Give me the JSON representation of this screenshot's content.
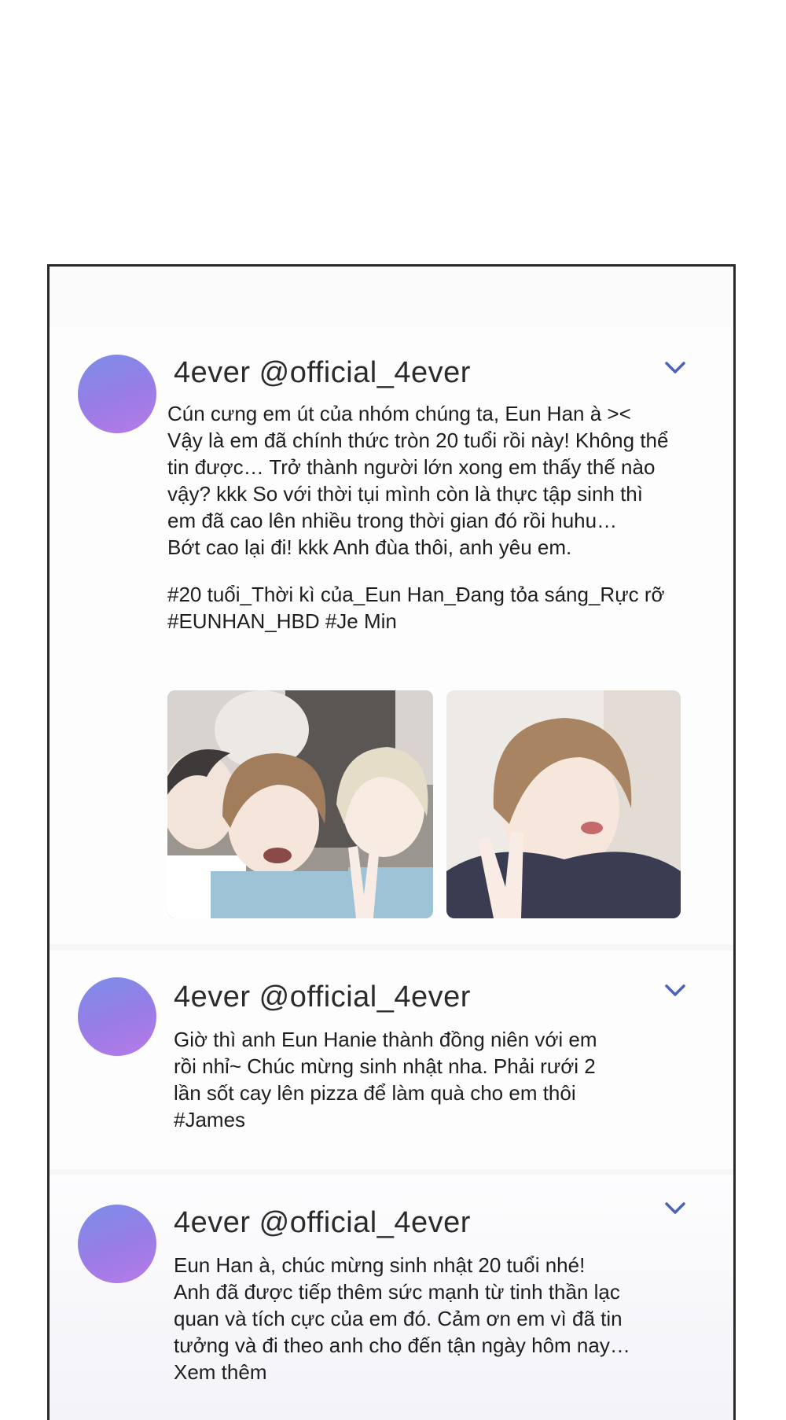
{
  "tweets": [
    {
      "header": "4ever @official_4ever",
      "lines": [
        "Cún cưng em út của nhóm chúng ta, Eun Han à ><",
        "Vậy là em đã chính thức tròn 20 tuổi rồi này! Không thể",
        "tin được… Trở thành người lớn xong em thấy thế nào",
        "vậy? kkk So với thời tụi mình còn là thực tập sinh thì",
        "em đã cao lên nhiều trong thời gian đó rồi huhu…",
        "Bớt cao lại đi! kkk Anh đùa thôi, anh yêu em."
      ],
      "hashtags": [
        "#20 tuổi_Thời kì của_Eun Han_Đang tỏa sáng_Rực rỡ",
        "#EUNHAN_HBD #Je Min"
      ]
    },
    {
      "header": "4ever @official_4ever",
      "lines": [
        "Giờ thì anh Eun Hanie thành đồng niên với em",
        "rồi nhỉ~ Chúc mừng sinh nhật nha. Phải rưới 2",
        "lần sốt cay lên pizza để làm quà cho em thôi",
        "#James"
      ]
    },
    {
      "header": "4ever @official_4ever",
      "lines": [
        "Eun Han à, chúc mừng sinh nhật 20 tuổi nhé!",
        "Anh đã được tiếp thêm sức mạnh từ tinh thần lạc",
        "quan và tích cực của em đó. Cảm ơn em vì đã tin",
        "tưởng và đi theo anh cho đến tận ngày hôm nay…",
        "Xem thêm"
      ]
    }
  ],
  "icons": {
    "avatar": "avatar-circle",
    "chevron": "chevron-down-icon"
  },
  "colors": {
    "avatar_gradient_start": "#7b8ee8",
    "avatar_gradient_end": "#b87ae8",
    "chevron": "#4a63b8",
    "frame_border": "#2a2a2a"
  }
}
